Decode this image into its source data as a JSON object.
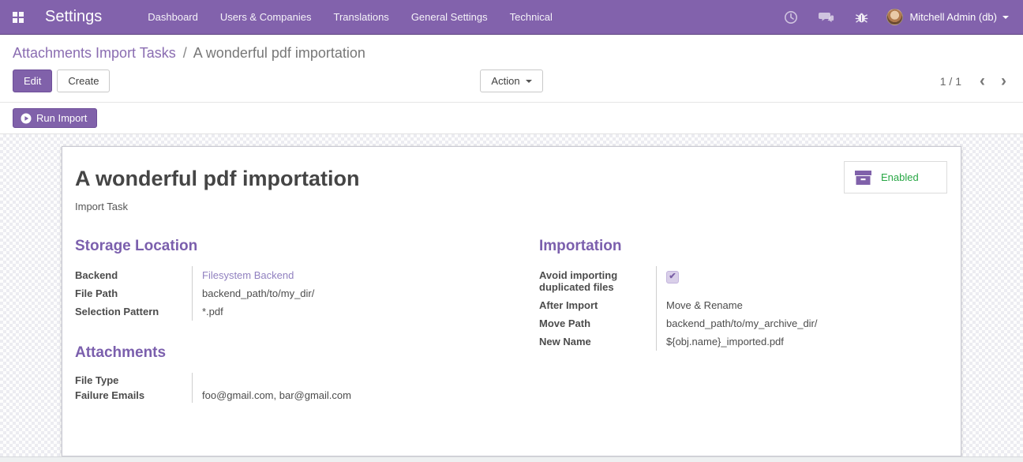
{
  "navbar": {
    "app_title": "Settings",
    "menu": [
      "Dashboard",
      "Users & Companies",
      "Translations",
      "General Settings",
      "Technical"
    ],
    "user_name": "Mitchell Admin (db)"
  },
  "breadcrumb": {
    "parent": "Attachments Import Tasks",
    "separator": "/",
    "current": "A wonderful pdf importation"
  },
  "control_panel": {
    "edit_label": "Edit",
    "create_label": "Create",
    "action_label": "Action",
    "pager_value": "1 / 1",
    "pager_prev": "‹",
    "pager_next": "›"
  },
  "statusbar": {
    "run_import_label": "Run Import"
  },
  "form": {
    "title": "A wonderful pdf importation",
    "subtitle": "Import Task",
    "enabled_button": {
      "label": "Enabled",
      "text_color": "#28a745",
      "icon": "archive-box-icon"
    },
    "storage": {
      "title": "Storage Location",
      "fields": [
        {
          "label": "Backend",
          "value": "Filesystem Backend"
        },
        {
          "label": "File Path",
          "value": "backend_path/to/my_dir/"
        },
        {
          "label": "Selection Pattern",
          "value": "*.pdf"
        }
      ]
    },
    "importation": {
      "title": "Importation",
      "checkbox_field": {
        "label": "Avoid importing duplicated files",
        "checked": true,
        "check_glyph": "✔"
      },
      "fields": [
        {
          "label": "After Import",
          "value": "Move & Rename"
        },
        {
          "label": "Move Path",
          "value": "backend_path/to/my_archive_dir/"
        },
        {
          "label": "New Name",
          "value": "${obj.name}_imported.pdf"
        }
      ]
    },
    "attachments": {
      "title": "Attachments",
      "fields": [
        {
          "label": "File Type",
          "value": ""
        },
        {
          "label": "Failure Emails",
          "value": "foo@gmail.com, bar@gmail.com"
        }
      ]
    }
  },
  "colors": {
    "navbar_bg": "#8262ac",
    "primary_button": "#8061aa",
    "section_title": "#7b5fad",
    "enabled_green": "#28a745"
  }
}
